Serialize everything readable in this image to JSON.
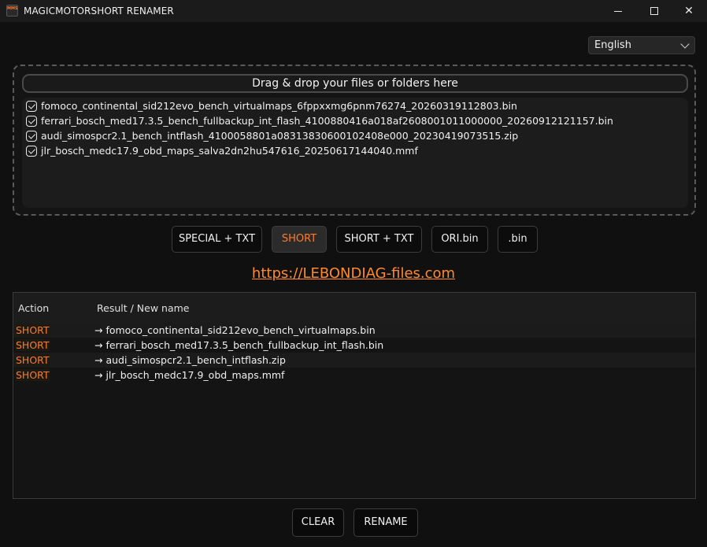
{
  "window": {
    "title": "MAGICMOTORSHORT RENAMER",
    "icon_label": "MMS",
    "controls": [
      "minimize-icon",
      "maximize-icon",
      "close-icon"
    ],
    "close_glyph": "✕"
  },
  "language": {
    "selected": "English"
  },
  "dropzone": {
    "header": "Drag & drop your files or folders here",
    "files": [
      {
        "name": "fomoco_continental_sid212evo_bench_virtualmaps_6fppxxmg6pnm76274_20260319112803.bin",
        "checked": true
      },
      {
        "name": "ferrari_bosch_med17.3.5_bench_fullbackup_int_flash_4100880416a018af2608001011000000_20260912121157.bin",
        "checked": true
      },
      {
        "name": "audi_simospcr2.1_bench_intflash_4100058801a08313830600102408e000_20230419073515.zip",
        "checked": true
      },
      {
        "name": "jlr_bosch_medc17.9_obd_maps_salva2dn2hu547616_20250617144040.mmf",
        "checked": true
      }
    ]
  },
  "modes": [
    {
      "label": "SPECIAL + TXT",
      "active": false
    },
    {
      "label": "SHORT",
      "active": true
    },
    {
      "label": "SHORT + TXT",
      "active": false
    },
    {
      "label": "ORI.bin",
      "active": false
    },
    {
      "label": ".bin",
      "active": false
    }
  ],
  "link": {
    "text": "https://LEBONDIAG-files.com"
  },
  "results": {
    "headers": {
      "action": "Action",
      "result": "Result / New name"
    },
    "rows": [
      {
        "action": "SHORT",
        "result": "→ fomoco_continental_sid212evo_bench_virtualmaps.bin"
      },
      {
        "action": "SHORT",
        "result": "→ ferrari_bosch_med17.3.5_bench_fullbackup_int_flash.bin"
      },
      {
        "action": "SHORT",
        "result": "→ audi_simospcr2.1_bench_intflash.zip"
      },
      {
        "action": "SHORT",
        "result": "→ jlr_bosch_medc17.9_obd_maps.mmf"
      }
    ]
  },
  "buttons": {
    "clear": "CLEAR",
    "rename": "RENAME"
  },
  "colors": {
    "accent": "#ff7a2a",
    "background": "#101010"
  }
}
